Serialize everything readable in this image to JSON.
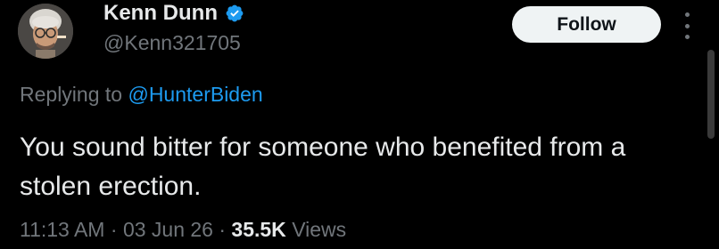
{
  "author": {
    "display_name": "Kenn Dunn",
    "handle": "@Kenn321705",
    "verified": true,
    "badge_color": "#1d9bf0"
  },
  "follow_button": {
    "label": "Follow"
  },
  "more_menu": {
    "icon": "more-vertical-icon"
  },
  "reply": {
    "prefix": "Replying to",
    "mention": "@HunterBiden"
  },
  "tweet": {
    "text": "You sound bitter for someone who benefited from a stolen erection."
  },
  "meta": {
    "time": "11:13 AM",
    "separator": "·",
    "date": "03 Jun 26",
    "views_count": "35.5K",
    "views_label": "Views"
  },
  "colors": {
    "background": "#000000",
    "primary_text": "#e7e9ea",
    "secondary_text": "#71767b",
    "link": "#1d9bf0",
    "button_bg": "#eff3f4"
  }
}
